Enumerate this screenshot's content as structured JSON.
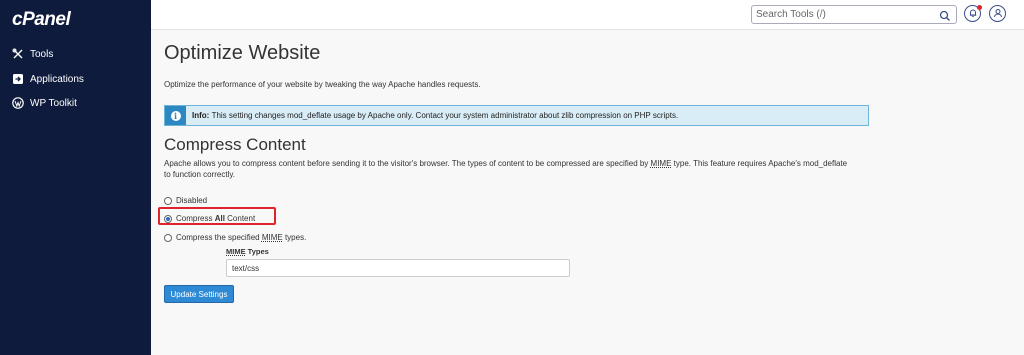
{
  "brand": {
    "logo": "cPanel"
  },
  "sidebar": {
    "items": [
      {
        "label": "Tools",
        "icon": "tools-icon"
      },
      {
        "label": "Applications",
        "icon": "applications-icon"
      },
      {
        "label": "WP Toolkit",
        "icon": "wordpress-icon"
      }
    ]
  },
  "header": {
    "search_placeholder": "Search Tools (/)",
    "icons": [
      "search-icon",
      "bell-icon",
      "user-icon"
    ]
  },
  "page": {
    "title": "Optimize Website",
    "description": "Optimize the performance of your website by tweaking the way Apache handles requests.",
    "info_label": "Info:",
    "info_text": "This setting changes mod_deflate usage by Apache only. Contact your system administrator about zlib compression on PHP scripts."
  },
  "compress": {
    "title": "Compress Content",
    "desc_part1": "Apache allows you to compress content before sending it to the visitor's browser. The types of content to be compressed are specified by ",
    "desc_abbr": "MIME",
    "desc_part2": " type. This feature requires Apache's mod_deflate to function correctly.",
    "options": {
      "disabled": "Disabled",
      "all_prefix": "Compress ",
      "all_bold": "All",
      "all_suffix": " Content",
      "specified_prefix": "Compress the specified ",
      "specified_abbr": "MIME",
      "specified_suffix": " types."
    },
    "selected": "all",
    "mime_label_abbr": "MIME",
    "mime_label_suffix": " Types",
    "mime_value": "text/css",
    "button": "Update Settings"
  },
  "colors": {
    "sidebar_bg": "#0e1b3d",
    "accent": "#2f8ad5",
    "info_bg": "#d9edf7",
    "highlight": "#e0242b"
  }
}
